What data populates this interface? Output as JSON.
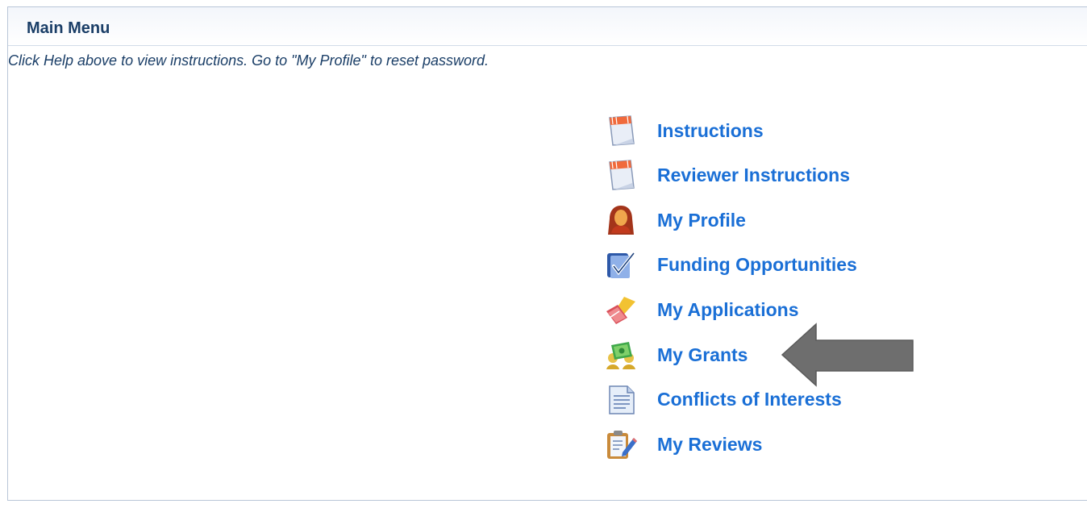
{
  "panel": {
    "title": "Main Menu",
    "help_text": "Click Help above to view instructions. Go to \"My Profile\" to reset password."
  },
  "menu": {
    "items": [
      {
        "label": "Instructions",
        "icon": "calendar-doc-icon"
      },
      {
        "label": "Reviewer Instructions",
        "icon": "calendar-doc-icon"
      },
      {
        "label": "My Profile",
        "icon": "user-profile-icon"
      },
      {
        "label": "Funding Opportunities",
        "icon": "checklist-icon"
      },
      {
        "label": "My Applications",
        "icon": "pencil-eraser-icon"
      },
      {
        "label": "My Grants",
        "icon": "money-users-icon"
      },
      {
        "label": "Conflicts of Interests",
        "icon": "document-icon"
      },
      {
        "label": "My Reviews",
        "icon": "clipboard-edit-icon"
      }
    ]
  },
  "annotation": {
    "arrow_color": "#6e6e6e",
    "points_to": "My Grants"
  },
  "colors": {
    "title": "#1a3e67",
    "link": "#1a6fd6"
  }
}
